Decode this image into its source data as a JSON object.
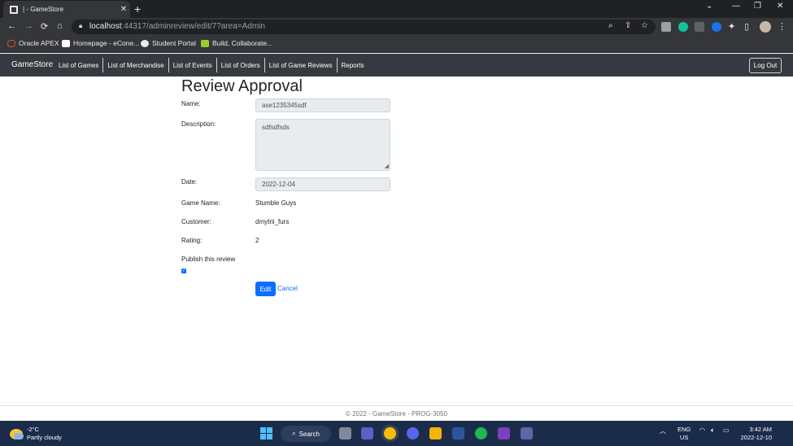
{
  "browser": {
    "tab_title": "| - GameStore",
    "tab_close": "✕",
    "new_tab": "+",
    "url_host": "localhost",
    "url_rest": ":44317/adminreview/edit/7?area=Admin",
    "bookmarks": [
      {
        "label": "Oracle APEX",
        "color": "#e34c26"
      },
      {
        "label": "Homepage - eCone...",
        "color": "#ffffff"
      },
      {
        "label": "Student Portal",
        "color": "#e8eaed"
      },
      {
        "label": "Build, Collaborate...",
        "color": "#9acd32"
      }
    ]
  },
  "navbar": {
    "brand": "GameStore",
    "links": [
      "List of Games",
      "List of Merchandise",
      "List of Events",
      "List of Orders",
      "List of Game Reviews",
      "Reports"
    ],
    "logout": "Log Out"
  },
  "form": {
    "title": "Review Approval",
    "name_label": "Name:",
    "name_value": "ase1235345sdf",
    "description_label": "Description:",
    "description_value": "sdfsdfsds",
    "date_label": "Date:",
    "date_value": "2022-12-04",
    "game_label": "Game Name:",
    "game_value": "Stumble Guys",
    "customer_label": "Customer:",
    "customer_value": "dmytrii_furs",
    "rating_label": "Rating:",
    "rating_value": "2",
    "publish_label": "Publish this review",
    "publish_checked": true,
    "edit_button": "Edit",
    "cancel_link": "Cancel"
  },
  "footer": {
    "text": "© 2022 - GameStore - PROG-3050"
  },
  "taskbar": {
    "temperature": "-2°C",
    "weather": "Partly cloudy",
    "search": "Search",
    "lang_1": "ENG",
    "lang_2": "US",
    "time": "3:42 AM",
    "date": "2022-12-10"
  },
  "colors": {
    "primary": "#0d6efd",
    "navbar": "#343a40",
    "taskbar": "#1b2c4b"
  }
}
